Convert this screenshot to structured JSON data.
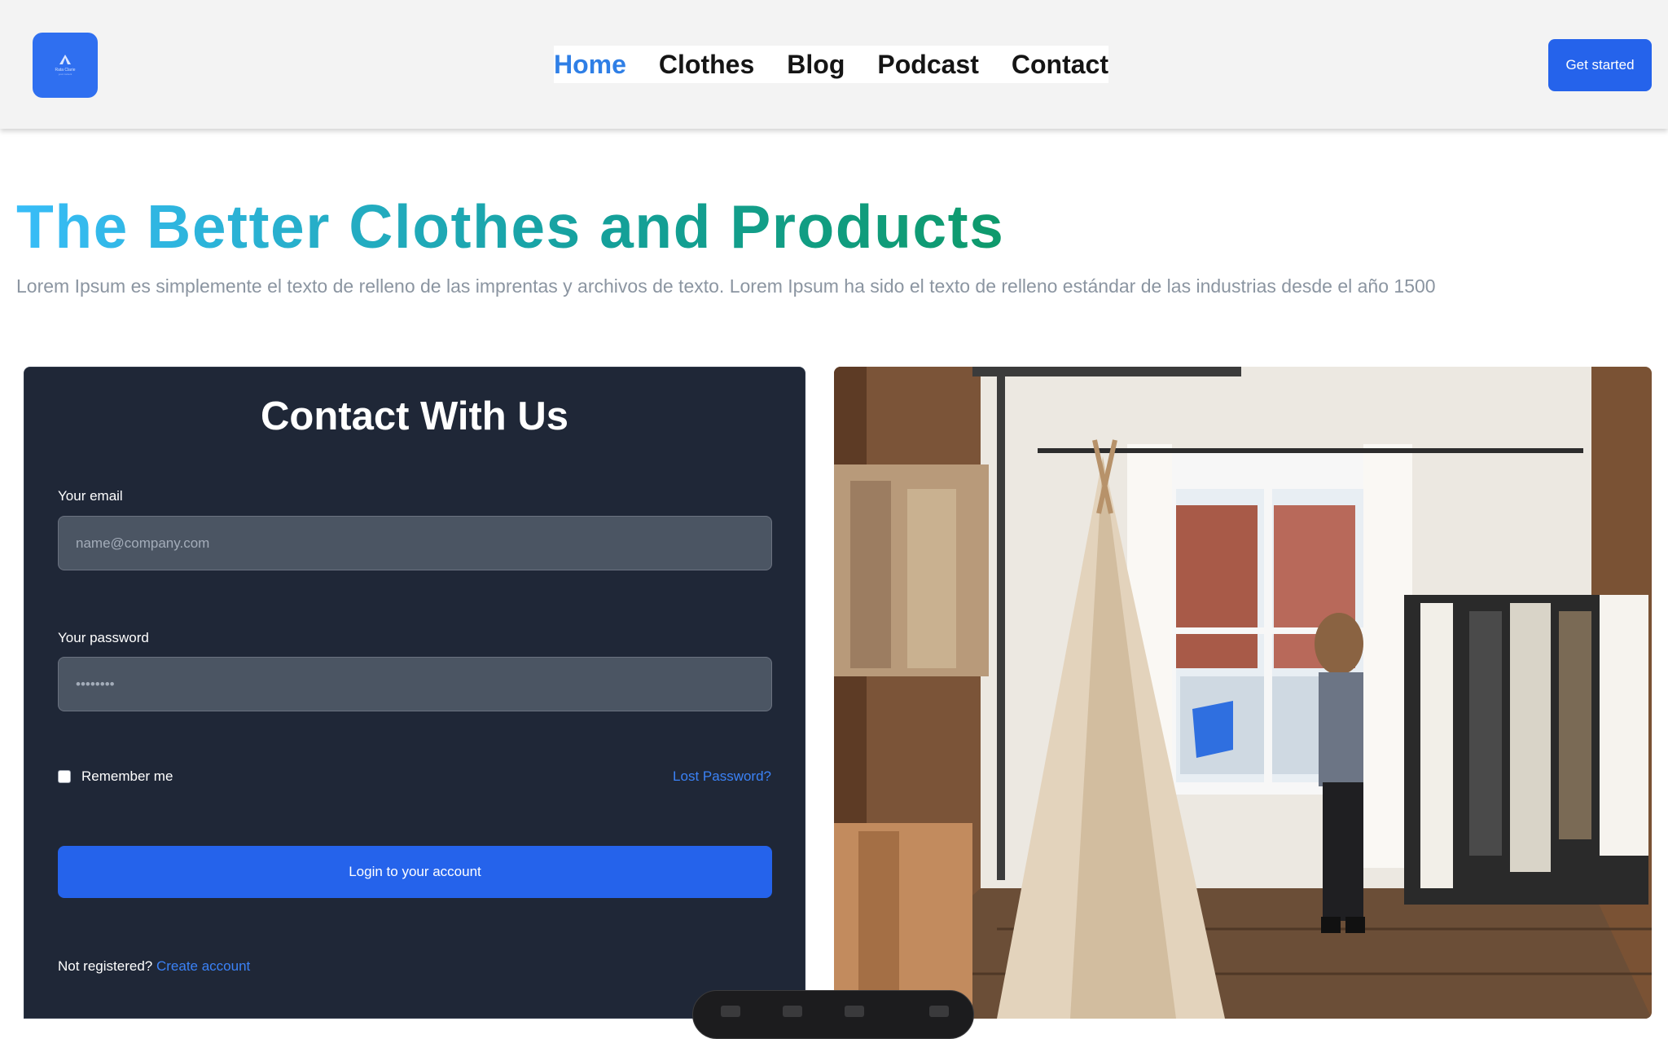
{
  "header": {
    "logo": {
      "icon": "mountain-logo-icon",
      "text": "Rata Clarie",
      "subtext": "your content"
    },
    "nav": [
      {
        "label": "Home",
        "active": true
      },
      {
        "label": "Clothes",
        "active": false
      },
      {
        "label": "Blog",
        "active": false
      },
      {
        "label": "Podcast",
        "active": false
      },
      {
        "label": "Contact",
        "active": false
      }
    ],
    "cta_label": "Get started"
  },
  "hero": {
    "title": "The Better Clothes and Products",
    "subtitle": "Lorem Ipsum es simplemente el texto de relleno de las imprentas y archivos de texto. Lorem Ipsum ha sido el texto de relleno estándar de las industrias desde el año 1500"
  },
  "contact_form": {
    "title": "Contact With Us",
    "email_label": "Your email",
    "email_placeholder": "name@company.com",
    "password_label": "Your password",
    "password_value": "••••••••",
    "remember_label": "Remember me",
    "remember_checked": false,
    "lost_password_label": "Lost Password?",
    "login_label": "Login to your account",
    "not_registered_text": "Not registered?",
    "create_account_label": "Create account"
  },
  "colors": {
    "accent": "#2563eb",
    "nav_active": "#2f7fe6",
    "card_bg": "#1f2737",
    "title_gradient_start": "#38bdf8",
    "title_gradient_end": "#0e9a6b"
  }
}
